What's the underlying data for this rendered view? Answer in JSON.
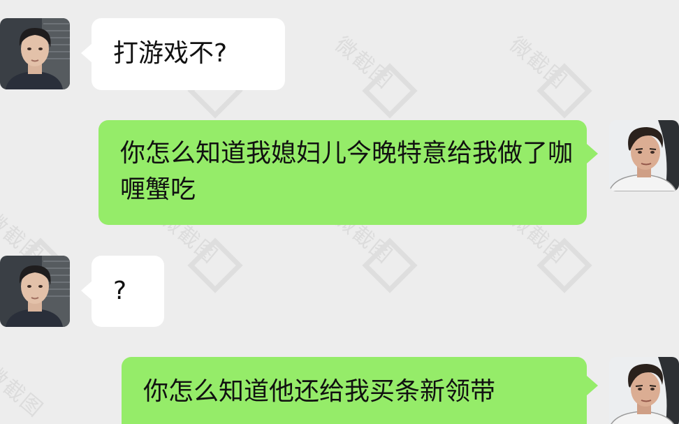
{
  "watermark": {
    "text": "微截图"
  },
  "messages": [
    {
      "side": "in",
      "sender": "friend",
      "text": "打游戏不?"
    },
    {
      "side": "out",
      "sender": "me",
      "text": "你怎么知道我媳妇儿今晚特意给我做了咖喱蟹吃"
    },
    {
      "side": "in",
      "sender": "friend",
      "text": "?"
    },
    {
      "side": "out",
      "sender": "me",
      "text": "你怎么知道他还给我买条新领带"
    }
  ],
  "colors": {
    "background": "#ededed",
    "incoming_bubble": "#ffffff",
    "outgoing_bubble": "#95ec69"
  }
}
